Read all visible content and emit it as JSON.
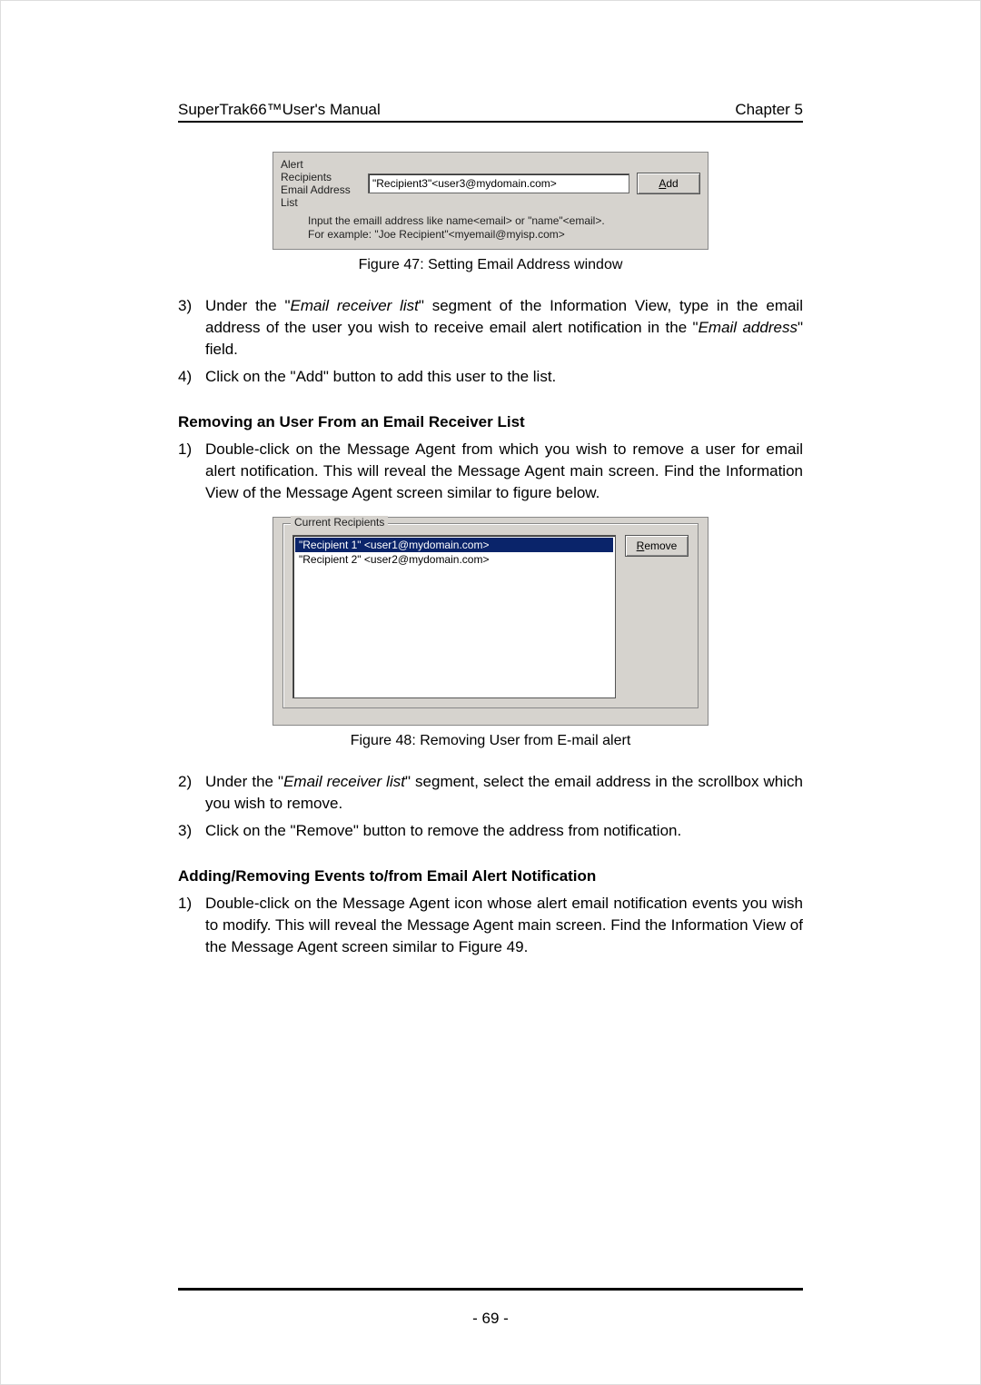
{
  "header": {
    "left": "SuperTrak66™User's Manual",
    "right": "Chapter 5"
  },
  "fig47": {
    "label_line1": "Alert",
    "label_line2": "Recipients",
    "label_line3": "Email Address",
    "label_line4": "List",
    "input_value": "\"Recipient3\"<user3@mydomain.com>",
    "add_prefix": "A",
    "add_rest": "dd",
    "hint_line1": "Input the emaill address like name<email> or \"name\"<email>.",
    "hint_line2": "For example: \"Joe Recipient\"<myemail@myisp.com>",
    "caption": "Figure 47: Setting Email Address window"
  },
  "step3": {
    "num": "3)",
    "pre": "Under the \"",
    "italic": "Email receiver list",
    "post": "\" segment of the Information View, type in the email address of the user you wish to receive email alert notification in the \"",
    "italic2": "Email address",
    "post2": "\" field."
  },
  "step4": {
    "num": "4)",
    "text": "Click on the \"Add\" button to add this user to the list."
  },
  "removing": {
    "heading": "Removing an User From an Email Receiver List",
    "s1_num": "1)",
    "s1_text": "Double-click on the Message Agent from which you wish to remove a user for email alert notification. This will reveal the Message Agent main screen. Find the Information View of the Message Agent screen similar to figure below."
  },
  "fig48": {
    "legend": "Current Recipients",
    "item1": "\"Recipient 1\" <user1@mydomain.com>",
    "item2": "\"Recipient 2\" <user2@mydomain.com>",
    "remove_prefix": "R",
    "remove_rest": "emove",
    "caption": "Figure 48: Removing User from E-mail alert"
  },
  "step_r2": {
    "num": "2)",
    "pre": "Under the \"",
    "italic": "Email receiver list",
    "post": "\" segment, select the email address in the scrollbox which you wish to remove."
  },
  "step_r3": {
    "num": "3)",
    "text": "Click on the \"Remove\" button to remove the address from notification."
  },
  "adding": {
    "heading": "Adding/Removing Events to/from Email Alert Notification",
    "s1_num": "1)",
    "s1_text": "Double-click on the Message Agent icon whose alert email notification  events you wish to modify. This will reveal the Message Agent main screen. Find the Information View of the Message Agent screen similar to Figure 49."
  },
  "page_number": "- 69 -"
}
